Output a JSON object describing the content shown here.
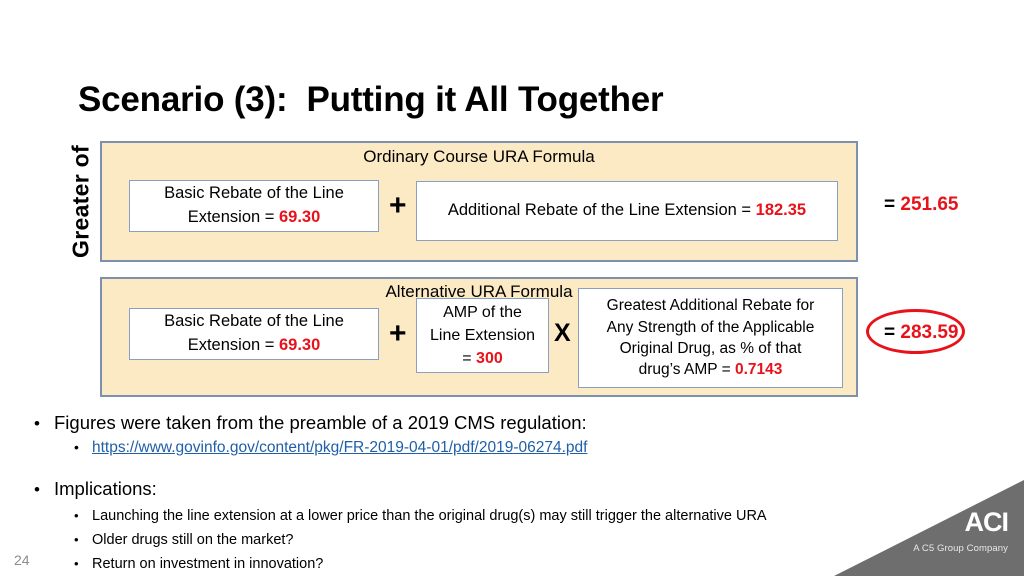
{
  "slide": {
    "title": "Scenario (3):  Putting it All Together",
    "number": "24",
    "greater_of_label": "Greater of"
  },
  "formulas": {
    "ordinary": {
      "heading": "Ordinary Course URA Formula",
      "basic_rebate_line1": "Basic Rebate of the Line",
      "basic_rebate_line2_prefix": "Extension = ",
      "basic_rebate_value": "69.30",
      "operator": "+",
      "additional_rebate_text": "Additional Rebate of the Line Extension = ",
      "additional_rebate_value": "182.35",
      "result_equals": "= ",
      "result_value": "251.65"
    },
    "alternative": {
      "heading": "Alternative URA Formula",
      "basic_rebate_line1": "Basic Rebate of the Line",
      "basic_rebate_line2_prefix": "Extension = ",
      "basic_rebate_value": "69.30",
      "operator_plus": "+",
      "amp_line1": "AMP of the",
      "amp_line2": "Line Extension",
      "amp_line3_prefix": "= ",
      "amp_value": "300",
      "operator_times": "X",
      "greatest_line1": "Greatest Additional Rebate for",
      "greatest_line2": "Any Strength of the Applicable",
      "greatest_line3": "Original Drug, as % of that",
      "greatest_line4_prefix": "drug’s AMP = ",
      "greatest_value": "0.7143",
      "result_equals": "= ",
      "result_value": "283.59"
    }
  },
  "bullets": {
    "source_heading": "Figures were taken from the preamble of a 2019 CMS regulation:",
    "source_link": "https://www.govinfo.gov/content/pkg/FR-2019-04-01/pdf/2019-06274.pdf",
    "implications_heading": "Implications:",
    "implications": [
      "Launching the line extension at a lower price than the original drug(s) may still trigger the alternative URA",
      "Older drugs still on the market?",
      "Return on investment in innovation?"
    ],
    "marker_level1": "•",
    "marker_level2": "•"
  },
  "branding": {
    "logo": "ACI",
    "tagline": "A C5 Group Company"
  },
  "colors": {
    "panel_fill": "#FCEAC4",
    "panel_border": "#7D90AE",
    "value_red": "#E8131A",
    "link_blue": "#1F5FA9",
    "triangle_gray": "#6E6E6E"
  }
}
